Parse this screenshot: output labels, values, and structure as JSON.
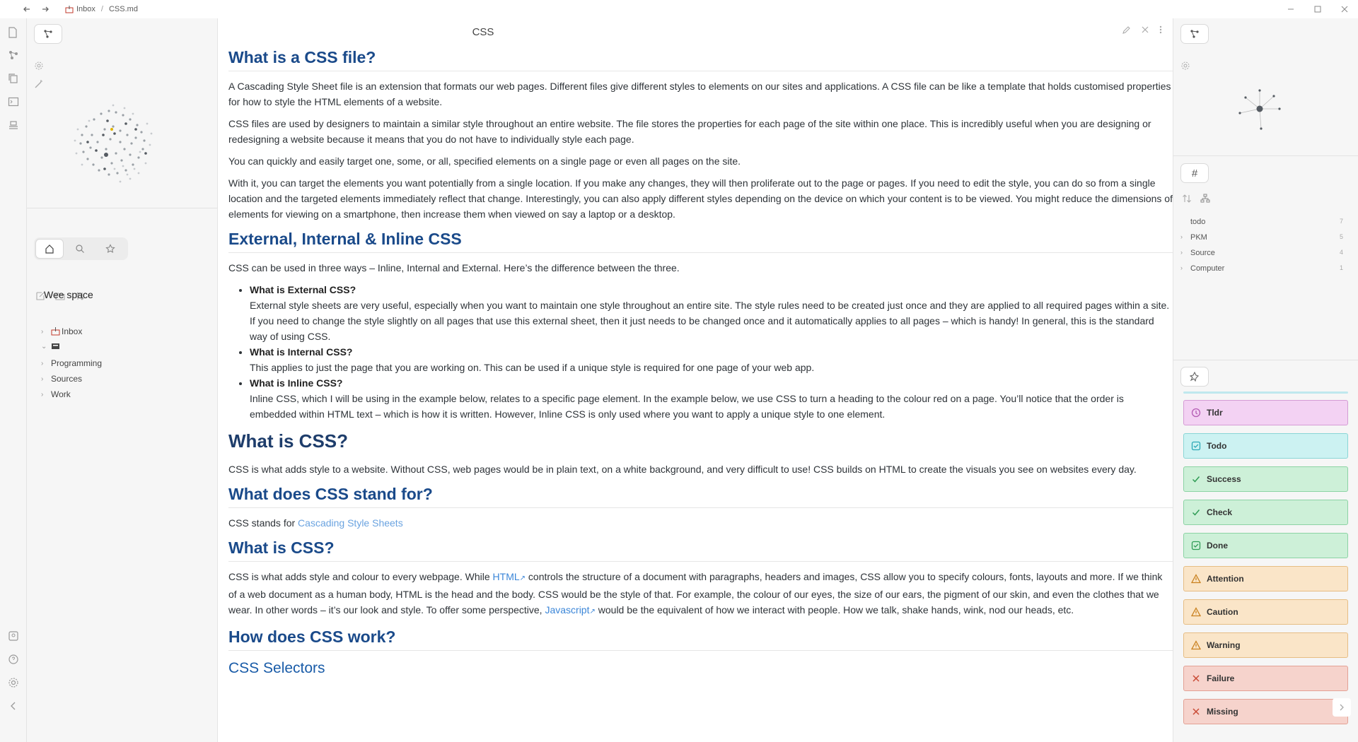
{
  "titlebar": {
    "breadcrumb_folder": "Inbox",
    "breadcrumb_sep": "/",
    "breadcrumb_file": "CSS.md"
  },
  "left": {
    "vault_name": "Wee space",
    "tree": [
      {
        "label": "Inbox",
        "expanded": false,
        "icon": "inbox-icon"
      },
      {
        "label": "",
        "expanded": true,
        "icon": "archive-box-icon"
      },
      {
        "label": "Programming",
        "expanded": false
      },
      {
        "label": "Sources",
        "expanded": false
      },
      {
        "label": "Work",
        "expanded": false
      }
    ]
  },
  "note": {
    "title": "CSS",
    "h1": "What is a CSS file?",
    "p1": "A Cascading Style Sheet file is an extension that formats our web pages. Different files give different styles to elements on our sites and applications. A CSS file can be like a template that holds customised properties for how to style the HTML elements of a website.",
    "p2": "CSS files are used by designers to maintain a similar style throughout an entire website. The file stores the properties for each page of the site within one place. This is incredibly useful when you are designing or redesigning a website because it means that you do not have to individually style each page.",
    "p3": "You can quickly and easily target one, some, or all, specified elements on a single page or even all pages on the site.",
    "p4": "With it, you can target the elements you want potentially from a single location. If you make any changes, they will then proliferate out to the page or pages. If you need to edit the style, you can do so from a single location and the targeted elements immediately reflect that change. Interestingly, you can also apply different styles depending on the device on which your content is to be viewed. You might reduce the dimensions of elements for viewing on a smartphone, then increase them when viewed on say a laptop or a desktop.",
    "h2": "External, Internal & Inline CSS",
    "p5": "CSS can be used in three ways – Inline, Internal and External. Here’s the difference between the three.",
    "bullets": [
      {
        "title": "What is External CSS?",
        "text": "External style sheets are very useful, especially when you want to maintain one style throughout an entire site. The style rules need to be created just once and they are applied to all required pages within a site. If you need to change the style slightly on all pages that use this external sheet, then it just needs to be changed once and it automatically applies to all pages – which is handy! In general, this is the standard way of using CSS."
      },
      {
        "title": "What is Internal CSS?",
        "text": "This applies to just the page that you are working on. This can be used if a unique style is required for one page of your web app."
      },
      {
        "title": "What is Inline CSS?",
        "text": "Inline CSS, which I will be using in the example below, relates to a specific page element. In the example below, we use CSS to turn a heading to the colour red on a page. You’ll notice that the order is embedded within HTML text – which is how it is written. However, Inline CSS is only used where you want to apply a unique style to one element."
      }
    ],
    "h3": "What is CSS?",
    "p6": "CSS is what adds style to a website. Without CSS, web pages would be in plain text, on a white background, and very difficult to use! CSS builds on HTML to create the visuals you see on websites every day.",
    "h4": "What does CSS stand for?",
    "p7_pre": "CSS stands for ",
    "p7_link": "Cascading Style Sheets",
    "h5": "What is CSS?",
    "p8_a": "CSS is what adds style and colour to every webpage. While ",
    "p8_link1": "HTML",
    "p8_b": " controls the structure of a document with paragraphs, headers and images, CSS allow you to specify colours, fonts, layouts and more. If we think of a web document as a human body, HTML is the head and the body. CSS would be the style of that. For example, the colour of our eyes, the size of our ears, the pigment of our skin, and even the clothes that we wear. In other words – it’s our look and style. To offer some perspective, ",
    "p8_link2": "Javascript",
    "p8_c": " would be the equivalent of how we interact with people. How we talk, shake hands, wink, nod our heads, etc.",
    "h6": "How does CSS work?",
    "h7": "CSS Selectors"
  },
  "right": {
    "tag_button": "#",
    "tags": [
      {
        "label": "todo",
        "count": "7",
        "expandable": false
      },
      {
        "label": "PKM",
        "count": "5",
        "expandable": true
      },
      {
        "label": "Source",
        "count": "4",
        "expandable": true
      },
      {
        "label": "Computer",
        "count": "1",
        "expandable": true
      }
    ],
    "callouts": [
      {
        "label": "Tldr",
        "bg": "#f3d2f3",
        "border": "#d59bd5",
        "icon_color": "#b45cb4",
        "icon": "clock-icon"
      },
      {
        "label": "Todo",
        "bg": "#ccf2f2",
        "border": "#8ad6d6",
        "icon_color": "#2aa7b5",
        "icon": "checkbox-icon"
      },
      {
        "label": "Success",
        "bg": "#cdf0d8",
        "border": "#8cd3a4",
        "icon_color": "#2f9c55",
        "icon": "check-icon"
      },
      {
        "label": "Check",
        "bg": "#cdf0d8",
        "border": "#8cd3a4",
        "icon_color": "#2f9c55",
        "icon": "check-icon"
      },
      {
        "label": "Done",
        "bg": "#cdf0d8",
        "border": "#8cd3a4",
        "icon_color": "#2f9c55",
        "icon": "checkbox-icon"
      },
      {
        "label": "Attention",
        "bg": "#fae5c8",
        "border": "#e6bd84",
        "icon_color": "#c9801e",
        "icon": "warning-icon"
      },
      {
        "label": "Caution",
        "bg": "#fae5c8",
        "border": "#e6bd84",
        "icon_color": "#c9801e",
        "icon": "warning-icon"
      },
      {
        "label": "Warning",
        "bg": "#fae5c8",
        "border": "#e6bd84",
        "icon_color": "#c9801e",
        "icon": "warning-icon"
      },
      {
        "label": "Failure",
        "bg": "#f6d3cc",
        "border": "#e3a195",
        "icon_color": "#c94a34",
        "icon": "x-icon"
      },
      {
        "label": "Missing",
        "bg": "#f6d3cc",
        "border": "#e3a195",
        "icon_color": "#c94a34",
        "icon": "x-icon"
      }
    ]
  },
  "colors": {
    "heading": "#1a4a8a",
    "link": "#3b86d8",
    "panel_bg": "#f6f6f6"
  }
}
